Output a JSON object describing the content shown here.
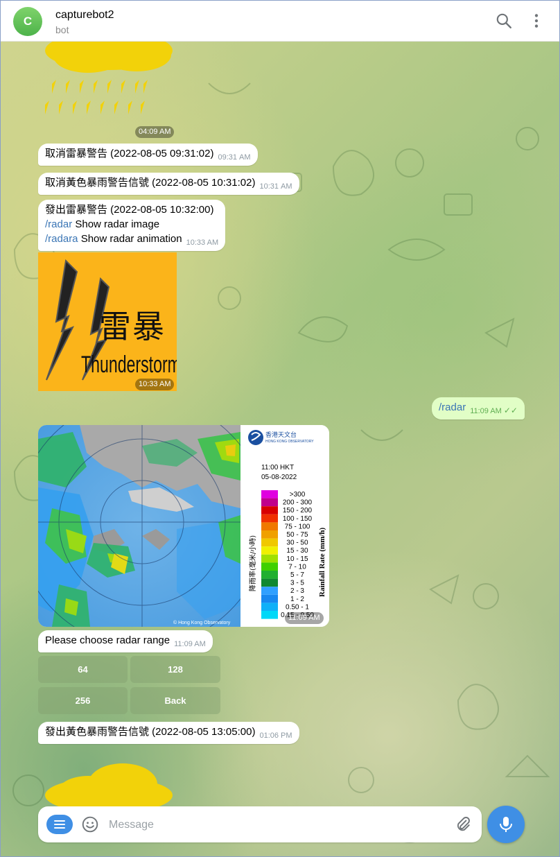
{
  "header": {
    "avatar_letter": "C",
    "title": "capturebot2",
    "subtitle": "bot",
    "search_icon": "search-icon",
    "menu_icon": "more-vertical-icon"
  },
  "messages": {
    "sticker1_time": "04:09 AM",
    "m1_text": "取消雷暴警告 (2022-08-05 09:31:02)",
    "m1_time": "09:31 AM",
    "m2_text": "取消黃色暴雨警告信號 (2022-08-05 10:31:02)",
    "m2_time": "10:31 AM",
    "m3_line1": "發出雷暴警告 (2022-08-05 10:32:00)",
    "m3_cmd1": "/radar",
    "m3_desc1": " Show radar image",
    "m3_cmd2": "/radara",
    "m3_desc2": " Show radar animation",
    "m3_time": "10:33 AM",
    "thunder_cn": "雷暴",
    "thunder_en": "Thunderstorm",
    "thunder_time": "10:33 AM",
    "out_cmd": "/radar",
    "out_time": "11:09 AM",
    "radar_time": "11:09 AM",
    "m4_text": "Please choose radar range",
    "m4_time": "11:09 AM",
    "m5_text": "發出黃色暴雨警告信號 (2022-08-05 13:05:00)",
    "m5_time": "01:06 PM"
  },
  "keyboard": {
    "b1": "64",
    "b2": "128",
    "b3": "256",
    "b4": "Back"
  },
  "radar": {
    "logo_cn": "香港天文台",
    "logo_en": "HONG KONG OBSERVATORY",
    "time": "11:00 HKT",
    "date": "05-08-2022",
    "axis_cn": "降雨率(毫米/小時)",
    "axis_en": "Rainfall Rate (mm/h)",
    "copyright": "© Hong Kong Observatory",
    "scale": [
      ">300",
      "200 - 300",
      "150 - 200",
      "100 - 150",
      "75 - 100",
      "50 - 75",
      "30 - 50",
      "15 - 30",
      "10 - 15",
      "7 - 10",
      "5 - 7",
      "3 - 5",
      "2 - 3",
      "1 - 2",
      "0.50 - 1",
      "0.15 - 0.50"
    ],
    "colors": [
      "#e000e0",
      "#c0008c",
      "#d80000",
      "#f03000",
      "#f07800",
      "#f0a000",
      "#f0c800",
      "#f0f000",
      "#a0e000",
      "#40d000",
      "#20b030",
      "#108830",
      "#30a0ff",
      "#1888f0",
      "#10b0f8",
      "#00d8f8"
    ]
  },
  "composer": {
    "placeholder": "Message"
  }
}
